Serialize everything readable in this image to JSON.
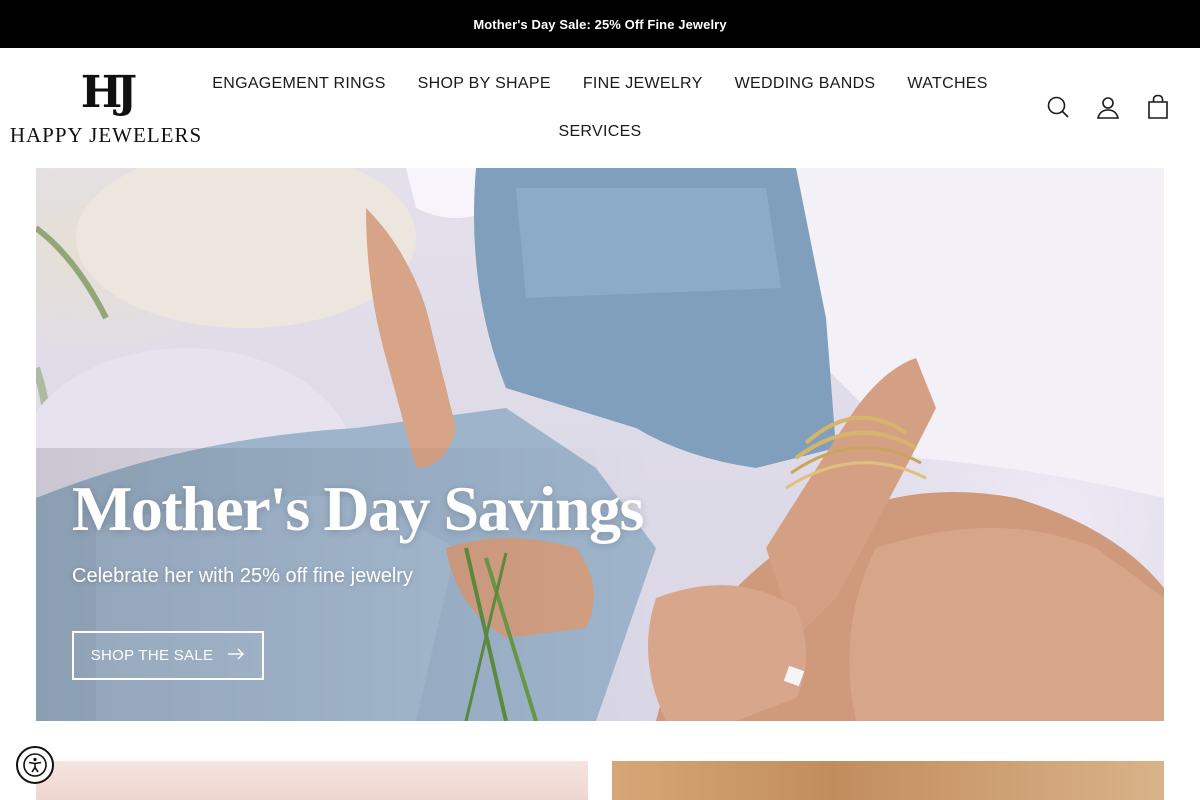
{
  "announcement": {
    "text": "Mother's Day Sale: 25% Off Fine Jewelry"
  },
  "logo": {
    "monogram": "HJ",
    "name": "HAPPY JEWELERS"
  },
  "nav": {
    "row1": [
      "ENGAGEMENT RINGS",
      "SHOP BY SHAPE",
      "FINE JEWELRY",
      "WEDDING BANDS",
      "WATCHES"
    ],
    "row2": [
      "SERVICES"
    ]
  },
  "header_icons": [
    "search-icon",
    "account-icon",
    "cart-icon"
  ],
  "hero": {
    "title": "Mother's Day Savings",
    "subtitle": "Celebrate her with 25% off fine jewelry",
    "cta_label": "SHOP THE SALE",
    "cta_icon": "arrow-right-icon"
  },
  "colors": {
    "announcement_bg": "#000000",
    "announcement_text": "#ffffff",
    "hero_text": "#ffffff",
    "nav_text": "#1a1a1a"
  },
  "accessibility": {
    "icon": "accessibility-icon"
  }
}
